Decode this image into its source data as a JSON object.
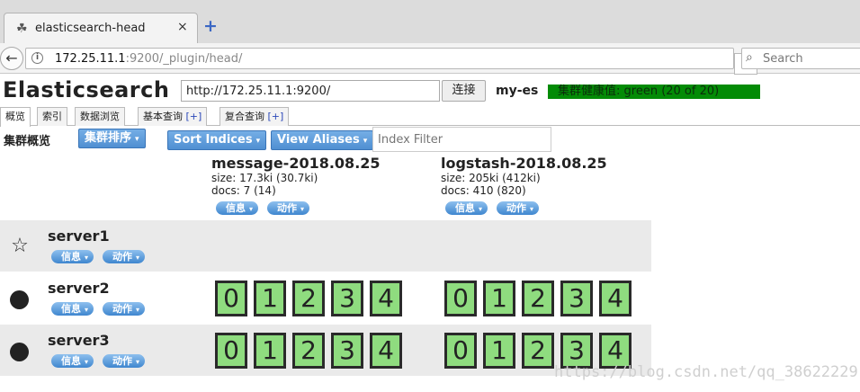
{
  "browser": {
    "tab_title": "elasticsearch-head",
    "tab_close": "×",
    "new_tab": "+",
    "url_host": "172.25.11.1",
    "url_rest": ":9200/_plugin/head/",
    "search_placeholder": "Search"
  },
  "app": {
    "title": "Elasticsearch",
    "connection_url": "http://172.25.11.1:9200/",
    "connect_label": "连接",
    "cluster_name": "my-es",
    "health_text": "集群健康值: green (20 of 20)",
    "health_color": "#038b06"
  },
  "tabs": [
    {
      "label": "概览",
      "plus": ""
    },
    {
      "label": "索引",
      "plus": ""
    },
    {
      "label": "数据浏览",
      "plus": ""
    },
    {
      "label": "基本查询",
      "plus": "[+]"
    },
    {
      "label": "复合查询",
      "plus": "[+]"
    }
  ],
  "toolbar": {
    "overview_label": "集群概览",
    "sort_cluster": "集群排序",
    "sort_indices": "Sort Indices",
    "view_aliases": "View Aliases",
    "index_filter_placeholder": "Index Filter"
  },
  "indices": [
    {
      "name": "message-2018.08.25",
      "size": "size: 17.3ki (30.7ki)",
      "docs": "docs: 7 (14)",
      "info": "信息",
      "action": "动作"
    },
    {
      "name": "logstash-2018.08.25",
      "size": "size: 205ki (412ki)",
      "docs": "docs: 410 (820)",
      "info": "信息",
      "action": "动作"
    }
  ],
  "nodes": [
    {
      "name": "server1",
      "icon": "star-icon",
      "info": "信息",
      "action": "动作",
      "shards": [
        [],
        []
      ]
    },
    {
      "name": "server2",
      "icon": "circle-icon",
      "info": "信息",
      "action": "动作",
      "shards": [
        [
          "0",
          "1",
          "2",
          "3",
          "4"
        ],
        [
          "0",
          "1",
          "2",
          "3",
          "4"
        ]
      ]
    },
    {
      "name": "server3",
      "icon": "circle-icon",
      "info": "信息",
      "action": "动作",
      "shards": [
        [
          "0",
          "1",
          "2",
          "3",
          "4"
        ],
        [
          "0",
          "1",
          "2",
          "3",
          "4"
        ]
      ]
    }
  ],
  "watermark": "https://blog.csdn.net/qq_38622229"
}
